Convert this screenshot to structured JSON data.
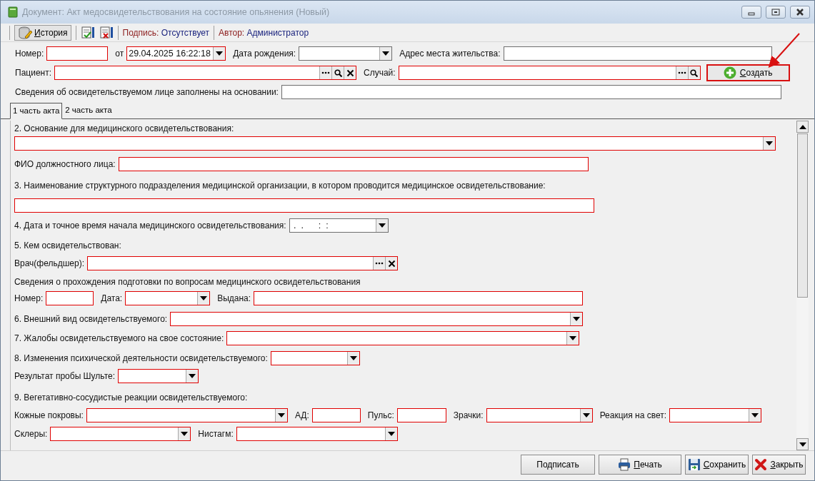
{
  "window": {
    "title": "Документ: Акт медосвидетельствования на состояние опьянения (Новый)"
  },
  "toolbar": {
    "history_button": "История",
    "signature_label": "Подпись:",
    "signature_value": "Отсутствует",
    "author_label": "Автор:",
    "author_value": "Администратор"
  },
  "header": [
    {
      "items": [
        {
          "kind": "label",
          "text": "Номер:"
        },
        {
          "kind": "text",
          "required": true
        },
        {
          "kind": "label",
          "text": "от"
        },
        {
          "kind": "combo",
          "required": true,
          "value": "29.04.2025 16:22:18"
        },
        {
          "kind": "label",
          "text": "Дата рождения:"
        },
        {
          "kind": "combo",
          "required": false
        },
        {
          "kind": "label",
          "text": "Адрес места жительства:"
        },
        {
          "kind": "text",
          "required": false
        }
      ]
    },
    {
      "items": [
        {
          "kind": "label",
          "text": "Пациент:"
        },
        {
          "kind": "lookup",
          "required": true,
          "searchable": true,
          "clearable": true
        },
        {
          "kind": "label",
          "text": "Случай:"
        },
        {
          "kind": "lookup",
          "required": true,
          "searchable": true,
          "clearable": false
        },
        {
          "kind": "button",
          "text": "Создать",
          "highlighted": true
        }
      ]
    },
    {
      "items": [
        {
          "kind": "label",
          "text": "Сведения об освидетельствуемом лице заполнены на основании:"
        },
        {
          "kind": "text",
          "required": false
        }
      ]
    }
  ],
  "tabs": [
    {
      "label": "1 часть акта",
      "selected": true
    },
    {
      "label": "2 часть акта",
      "selected": false
    }
  ],
  "form": [
    {
      "items": [
        {
          "kind": "heading",
          "text": "2. Основание для медицинского освидетельствования:"
        }
      ]
    },
    {
      "items": [
        {
          "kind": "combo",
          "required": true
        }
      ]
    },
    {
      "items": [
        {
          "kind": "label",
          "text": "ФИО должностного лица:"
        },
        {
          "kind": "text",
          "required": true
        }
      ]
    },
    {
      "items": [
        {
          "kind": "heading",
          "text": "3. Наименование структурного подразделения медицинской организации, в котором проводится медицинское освидетельствование:"
        }
      ]
    },
    {
      "items": [
        {
          "kind": "text",
          "required": true
        }
      ]
    },
    {
      "items": [
        {
          "kind": "label",
          "text": "4. Дата и точное время начала медицинского освидетельствования:"
        },
        {
          "kind": "combo",
          "required": false,
          "value": " .  .      :  :"
        }
      ]
    },
    {
      "items": [
        {
          "kind": "heading",
          "text": "5. Кем освидетельствован:"
        }
      ]
    },
    {
      "items": [
        {
          "kind": "label",
          "text": "Врач(фельдшер):"
        },
        {
          "kind": "lookup",
          "required": true,
          "searchable": false,
          "clearable": true
        }
      ]
    },
    {
      "items": [
        {
          "kind": "heading",
          "text": "Сведения о прохождения подготовки по вопросам медицинского освидетельствования"
        }
      ]
    },
    {
      "items": [
        {
          "kind": "label",
          "text": "Номер:"
        },
        {
          "kind": "text",
          "required": true
        },
        {
          "kind": "label",
          "text": "Дата:"
        },
        {
          "kind": "combo",
          "required": true
        },
        {
          "kind": "label",
          "text": "Выдана:"
        },
        {
          "kind": "text",
          "required": true
        }
      ]
    },
    {
      "items": [
        {
          "kind": "label",
          "text": "6. Внешний вид освидетельствуемого:"
        },
        {
          "kind": "combo",
          "required": true
        }
      ]
    },
    {
      "items": [
        {
          "kind": "label",
          "text": "7. Жалобы освидетельствуемого на свое состояние:"
        },
        {
          "kind": "combo",
          "required": true
        }
      ]
    },
    {
      "items": [
        {
          "kind": "label",
          "text": "8. Изменения психической деятельности освидетельствуемого:"
        },
        {
          "kind": "combo",
          "required": true
        }
      ]
    },
    {
      "items": [
        {
          "kind": "label",
          "text": "Результат пробы Шульте:"
        },
        {
          "kind": "combo",
          "required": true
        }
      ]
    },
    {
      "items": [
        {
          "kind": "heading",
          "text": "9. Вегетативно-сосудистые реакции освидетельствуемого:"
        }
      ]
    },
    {
      "items": [
        {
          "kind": "label",
          "text": "Кожные покровы:"
        },
        {
          "kind": "combo",
          "required": true
        },
        {
          "kind": "label",
          "text": "АД:"
        },
        {
          "kind": "text",
          "required": true
        },
        {
          "kind": "label",
          "text": "Пульс:"
        },
        {
          "kind": "text",
          "required": true
        },
        {
          "kind": "label",
          "text": "Зрачки:"
        },
        {
          "kind": "combo",
          "required": true
        },
        {
          "kind": "label",
          "text": "Реакция на свет:"
        },
        {
          "kind": "combo",
          "required": true
        }
      ]
    },
    {
      "items": [
        {
          "kind": "label",
          "text": "Склеры:"
        },
        {
          "kind": "combo",
          "required": true
        },
        {
          "kind": "label",
          "text": "Нистагм:"
        },
        {
          "kind": "combo",
          "required": true
        }
      ]
    }
  ],
  "buttons": [
    {
      "kind": "sign",
      "label": "Подписать"
    },
    {
      "kind": "print",
      "label": "Печать"
    },
    {
      "kind": "save",
      "label": "Сохранить"
    },
    {
      "kind": "close",
      "label": "Закрыть"
    }
  ]
}
